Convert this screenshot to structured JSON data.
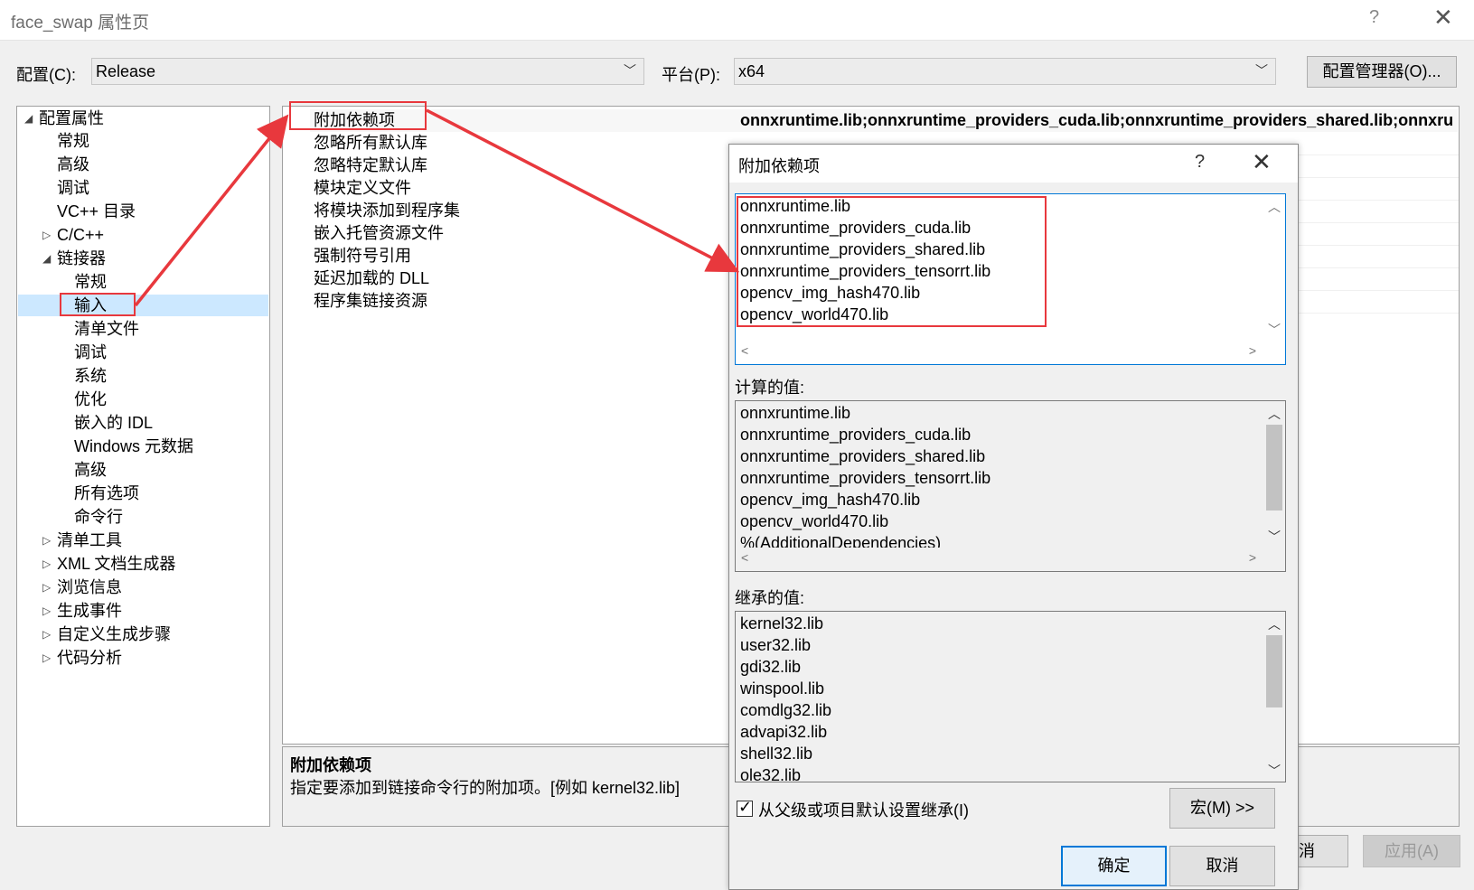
{
  "window": {
    "title": "face_swap 属性页",
    "help": "?",
    "close": "✕"
  },
  "toolbar": {
    "config_label": "配置(C):",
    "config_value": "Release",
    "platform_label": "平台(P):",
    "platform_value": "x64",
    "config_manager": "配置管理器(O)..."
  },
  "tree": {
    "items": [
      {
        "label": "配置属性",
        "expander": "◢"
      },
      {
        "label": "常规"
      },
      {
        "label": "高级"
      },
      {
        "label": "调试"
      },
      {
        "label": "VC++ 目录"
      },
      {
        "label": "C/C++",
        "expander": "▷"
      },
      {
        "label": "链接器",
        "expander": "◢"
      },
      {
        "label": "常规"
      },
      {
        "label": "输入"
      },
      {
        "label": "清单文件"
      },
      {
        "label": "调试"
      },
      {
        "label": "系统"
      },
      {
        "label": "优化"
      },
      {
        "label": "嵌入的 IDL"
      },
      {
        "label": "Windows 元数据"
      },
      {
        "label": "高级"
      },
      {
        "label": "所有选项"
      },
      {
        "label": "命令行"
      },
      {
        "label": "清单工具",
        "expander": "▷"
      },
      {
        "label": "XML 文档生成器",
        "expander": "▷"
      },
      {
        "label": "浏览信息",
        "expander": "▷"
      },
      {
        "label": "生成事件",
        "expander": "▷"
      },
      {
        "label": "自定义生成步骤",
        "expander": "▷"
      },
      {
        "label": "代码分析",
        "expander": "▷"
      }
    ]
  },
  "grid": {
    "properties": [
      {
        "name": "附加依赖项"
      },
      {
        "name": "忽略所有默认库"
      },
      {
        "name": "忽略特定默认库"
      },
      {
        "name": "模块定义文件"
      },
      {
        "name": "将模块添加到程序集"
      },
      {
        "name": "嵌入托管资源文件"
      },
      {
        "name": "强制符号引用"
      },
      {
        "name": "延迟加载的 DLL"
      },
      {
        "name": "程序集链接资源"
      }
    ],
    "first_value": "onnxruntime.lib;onnxruntime_providers_cuda.lib;onnxruntime_providers_shared.lib;onnxruntime_providers_tensorrt.lib;opencv_img_hash470.lib;opencv_world470.lib;%(AdditionalDependencies)"
  },
  "description": {
    "title": "附加依赖项",
    "text": "指定要添加到链接命令行的附加项。[例如 kernel32.lib]"
  },
  "buttons": {
    "cancel": "取消",
    "apply": "应用(A)"
  },
  "dialog": {
    "title": "附加依赖项",
    "help": "?",
    "close": "✕",
    "edit_lines": [
      "onnxruntime.lib",
      "onnxruntime_providers_cuda.lib",
      "onnxruntime_providers_shared.lib",
      "onnxruntime_providers_tensorrt.lib",
      "opencv_img_hash470.lib",
      "opencv_world470.lib"
    ],
    "computed_label": "计算的值:",
    "computed_lines": [
      "onnxruntime.lib",
      "onnxruntime_providers_cuda.lib",
      "onnxruntime_providers_shared.lib",
      "onnxruntime_providers_tensorrt.lib",
      "opencv_img_hash470.lib",
      "opencv_world470.lib",
      "%(AdditionalDependencies)"
    ],
    "inherited_label": "继承的值:",
    "inherited_lines": [
      "kernel32.lib",
      "user32.lib",
      "gdi32.lib",
      "winspool.lib",
      "comdlg32.lib",
      "advapi32.lib",
      "shell32.lib",
      "ole32.lib"
    ],
    "inherit_checkbox": "从父级或项目默认设置继承(I)",
    "inherit_checked": true,
    "macro_button": "宏(M) >>",
    "ok": "确定",
    "cancel": "取消"
  },
  "colors": {
    "annotation": "#e8383d",
    "selection": "#cce8ff",
    "focus": "#0078d7"
  }
}
